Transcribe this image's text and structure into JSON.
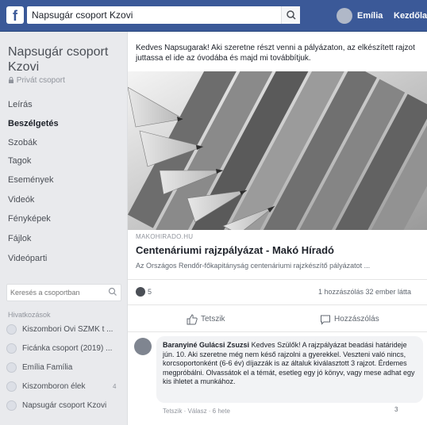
{
  "topbar": {
    "logo": "f",
    "search_value": "Napsugár csoport Kzovi",
    "user_name": "Emília",
    "nav_link": "Kezdőlap"
  },
  "sidebar": {
    "group_name": "Napsugár csoport Kzovi",
    "privacy": "Privát csoport",
    "nav_items": [
      {
        "label": "Leírás",
        "active": false
      },
      {
        "label": "Beszélgetés",
        "active": true
      },
      {
        "label": "Szobák",
        "active": false
      },
      {
        "label": "Tagok",
        "active": false
      },
      {
        "label": "Események",
        "active": false
      },
      {
        "label": "Videók",
        "active": false
      },
      {
        "label": "Fényképek",
        "active": false
      },
      {
        "label": "Fájlok",
        "active": false
      },
      {
        "label": "Videóparti",
        "active": false
      }
    ],
    "search_placeholder": "Keresés a csoportban",
    "shortcuts_heading": "Hivatkozások",
    "shortcuts": [
      {
        "label": "Kiszombori Ovi SZMK t ...",
        "count": ""
      },
      {
        "label": "Ficánka csoport (2019) ...",
        "count": ""
      },
      {
        "label": "Emília Família",
        "count": ""
      },
      {
        "label": "Kiszomboron élek",
        "count": "4"
      },
      {
        "label": "Napsugár csoport Kzovi",
        "count": ""
      }
    ]
  },
  "post": {
    "text": "Kedves Napsugarak! Aki szeretne részt venni a pályázaton, az elkészített rajzot juttassa el ide az óvodába és majd mi továbbítjuk.",
    "link_source": "MAKOHIRADO.HU",
    "link_title": "Centenáriumi rajzpályázat - Makó Híradó",
    "link_description": "Az Országos Rendőr-főkapitányság centenáriumi rajzkészítő pályázatot ...",
    "reaction_count": "5",
    "stats": "1 hozzászólás  32 ember látta",
    "like_label": "Tetszik",
    "comment_label": "Hozzászólás"
  },
  "comment": {
    "author": "Baranyiné Gulácsi Zsuzsi",
    "text": "Kedves Szülők! A rajzpályázat beadási határideje jún. 10. Aki szeretne még nem késő rajzolni a gyerekkel. Veszteni való nincs, korcsoportonként (6-6 év) díjazzák is az általuk kiválasztott 3 rajzot. Érdemes megpróbálni. Olvassátok el a témát, esetleg egy jó könyv, vagy mese adhat egy kis ihletet a munkához.",
    "meta": "Tetszik · Válasz · 6 hete",
    "reaction_count": "3"
  }
}
